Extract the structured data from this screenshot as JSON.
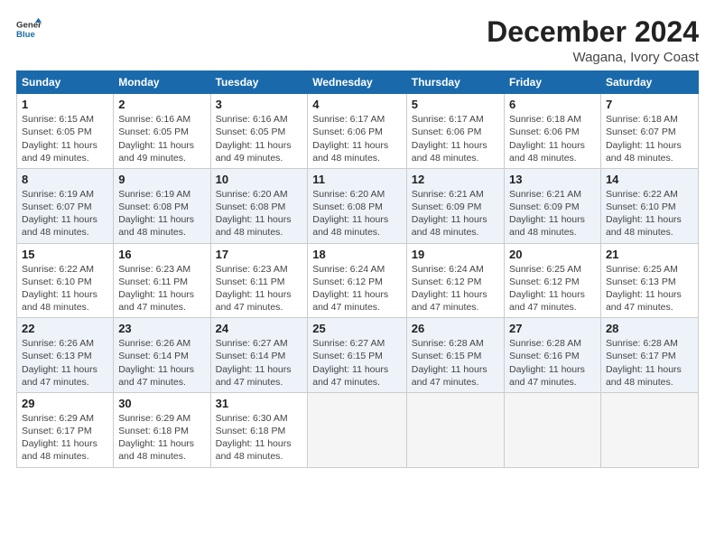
{
  "header": {
    "logo_line1": "General",
    "logo_line2": "Blue",
    "month_title": "December 2024",
    "subtitle": "Wagana, Ivory Coast"
  },
  "weekdays": [
    "Sunday",
    "Monday",
    "Tuesday",
    "Wednesday",
    "Thursday",
    "Friday",
    "Saturday"
  ],
  "weeks": [
    [
      {
        "day": "1",
        "info": "Sunrise: 6:15 AM\nSunset: 6:05 PM\nDaylight: 11 hours\nand 49 minutes."
      },
      {
        "day": "2",
        "info": "Sunrise: 6:16 AM\nSunset: 6:05 PM\nDaylight: 11 hours\nand 49 minutes."
      },
      {
        "day": "3",
        "info": "Sunrise: 6:16 AM\nSunset: 6:05 PM\nDaylight: 11 hours\nand 49 minutes."
      },
      {
        "day": "4",
        "info": "Sunrise: 6:17 AM\nSunset: 6:06 PM\nDaylight: 11 hours\nand 48 minutes."
      },
      {
        "day": "5",
        "info": "Sunrise: 6:17 AM\nSunset: 6:06 PM\nDaylight: 11 hours\nand 48 minutes."
      },
      {
        "day": "6",
        "info": "Sunrise: 6:18 AM\nSunset: 6:06 PM\nDaylight: 11 hours\nand 48 minutes."
      },
      {
        "day": "7",
        "info": "Sunrise: 6:18 AM\nSunset: 6:07 PM\nDaylight: 11 hours\nand 48 minutes."
      }
    ],
    [
      {
        "day": "8",
        "info": "Sunrise: 6:19 AM\nSunset: 6:07 PM\nDaylight: 11 hours\nand 48 minutes."
      },
      {
        "day": "9",
        "info": "Sunrise: 6:19 AM\nSunset: 6:08 PM\nDaylight: 11 hours\nand 48 minutes."
      },
      {
        "day": "10",
        "info": "Sunrise: 6:20 AM\nSunset: 6:08 PM\nDaylight: 11 hours\nand 48 minutes."
      },
      {
        "day": "11",
        "info": "Sunrise: 6:20 AM\nSunset: 6:08 PM\nDaylight: 11 hours\nand 48 minutes."
      },
      {
        "day": "12",
        "info": "Sunrise: 6:21 AM\nSunset: 6:09 PM\nDaylight: 11 hours\nand 48 minutes."
      },
      {
        "day": "13",
        "info": "Sunrise: 6:21 AM\nSunset: 6:09 PM\nDaylight: 11 hours\nand 48 minutes."
      },
      {
        "day": "14",
        "info": "Sunrise: 6:22 AM\nSunset: 6:10 PM\nDaylight: 11 hours\nand 48 minutes."
      }
    ],
    [
      {
        "day": "15",
        "info": "Sunrise: 6:22 AM\nSunset: 6:10 PM\nDaylight: 11 hours\nand 48 minutes."
      },
      {
        "day": "16",
        "info": "Sunrise: 6:23 AM\nSunset: 6:11 PM\nDaylight: 11 hours\nand 47 minutes."
      },
      {
        "day": "17",
        "info": "Sunrise: 6:23 AM\nSunset: 6:11 PM\nDaylight: 11 hours\nand 47 minutes."
      },
      {
        "day": "18",
        "info": "Sunrise: 6:24 AM\nSunset: 6:12 PM\nDaylight: 11 hours\nand 47 minutes."
      },
      {
        "day": "19",
        "info": "Sunrise: 6:24 AM\nSunset: 6:12 PM\nDaylight: 11 hours\nand 47 minutes."
      },
      {
        "day": "20",
        "info": "Sunrise: 6:25 AM\nSunset: 6:12 PM\nDaylight: 11 hours\nand 47 minutes."
      },
      {
        "day": "21",
        "info": "Sunrise: 6:25 AM\nSunset: 6:13 PM\nDaylight: 11 hours\nand 47 minutes."
      }
    ],
    [
      {
        "day": "22",
        "info": "Sunrise: 6:26 AM\nSunset: 6:13 PM\nDaylight: 11 hours\nand 47 minutes."
      },
      {
        "day": "23",
        "info": "Sunrise: 6:26 AM\nSunset: 6:14 PM\nDaylight: 11 hours\nand 47 minutes."
      },
      {
        "day": "24",
        "info": "Sunrise: 6:27 AM\nSunset: 6:14 PM\nDaylight: 11 hours\nand 47 minutes."
      },
      {
        "day": "25",
        "info": "Sunrise: 6:27 AM\nSunset: 6:15 PM\nDaylight: 11 hours\nand 47 minutes."
      },
      {
        "day": "26",
        "info": "Sunrise: 6:28 AM\nSunset: 6:15 PM\nDaylight: 11 hours\nand 47 minutes."
      },
      {
        "day": "27",
        "info": "Sunrise: 6:28 AM\nSunset: 6:16 PM\nDaylight: 11 hours\nand 47 minutes."
      },
      {
        "day": "28",
        "info": "Sunrise: 6:28 AM\nSunset: 6:17 PM\nDaylight: 11 hours\nand 48 minutes."
      }
    ],
    [
      {
        "day": "29",
        "info": "Sunrise: 6:29 AM\nSunset: 6:17 PM\nDaylight: 11 hours\nand 48 minutes."
      },
      {
        "day": "30",
        "info": "Sunrise: 6:29 AM\nSunset: 6:18 PM\nDaylight: 11 hours\nand 48 minutes."
      },
      {
        "day": "31",
        "info": "Sunrise: 6:30 AM\nSunset: 6:18 PM\nDaylight: 11 hours\nand 48 minutes."
      },
      {
        "day": "",
        "info": ""
      },
      {
        "day": "",
        "info": ""
      },
      {
        "day": "",
        "info": ""
      },
      {
        "day": "",
        "info": ""
      }
    ]
  ]
}
